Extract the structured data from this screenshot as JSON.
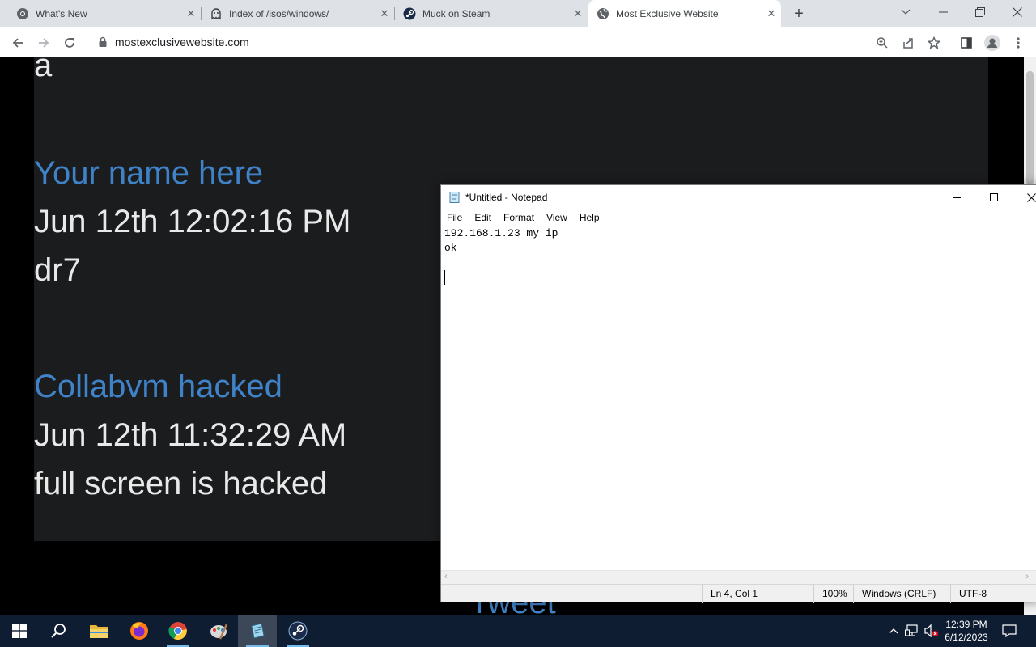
{
  "browser": {
    "tabs": [
      {
        "title": "What's New",
        "icon": "chrome-icon",
        "active": false
      },
      {
        "title": "Index of /isos/windows/",
        "icon": "ghost-icon",
        "active": false
      },
      {
        "title": "Muck on Steam",
        "icon": "steam-icon",
        "active": false
      },
      {
        "title": "Most Exclusive Website",
        "icon": "globe-icon",
        "active": true
      }
    ],
    "url": "mostexclusivewebsite.com"
  },
  "page": {
    "partial_top": "a",
    "entries": [
      {
        "name": "Your name here",
        "time": "Jun 12th 12:02:16 PM",
        "message": "dr7"
      },
      {
        "name": "Collabvm hacked",
        "time": "Jun 12th 11:32:29 AM",
        "message": "full screen is hacked"
      }
    ],
    "tweet_label": "Tweet",
    "colors": {
      "panel": "#1b1c1e",
      "link": "#3f82c7",
      "text": "#e9e9e9"
    }
  },
  "notepad": {
    "title": "*Untitled - Notepad",
    "menu": [
      "File",
      "Edit",
      "Format",
      "View",
      "Help"
    ],
    "lines": [
      "192.168.1.23 my ip",
      "ok",
      ""
    ],
    "status": {
      "position": "Ln 4, Col 1",
      "zoom": "100%",
      "line_ending": "Windows (CRLF)",
      "encoding": "UTF-8"
    }
  },
  "taskbar": {
    "apps": [
      "start-icon",
      "search-icon",
      "file-explorer-icon",
      "firefox-icon",
      "chrome-icon",
      "paint-icon",
      "notepad-icon",
      "steam-icon"
    ],
    "clock": {
      "time": "12:39 PM",
      "date": "6/12/2023"
    }
  }
}
